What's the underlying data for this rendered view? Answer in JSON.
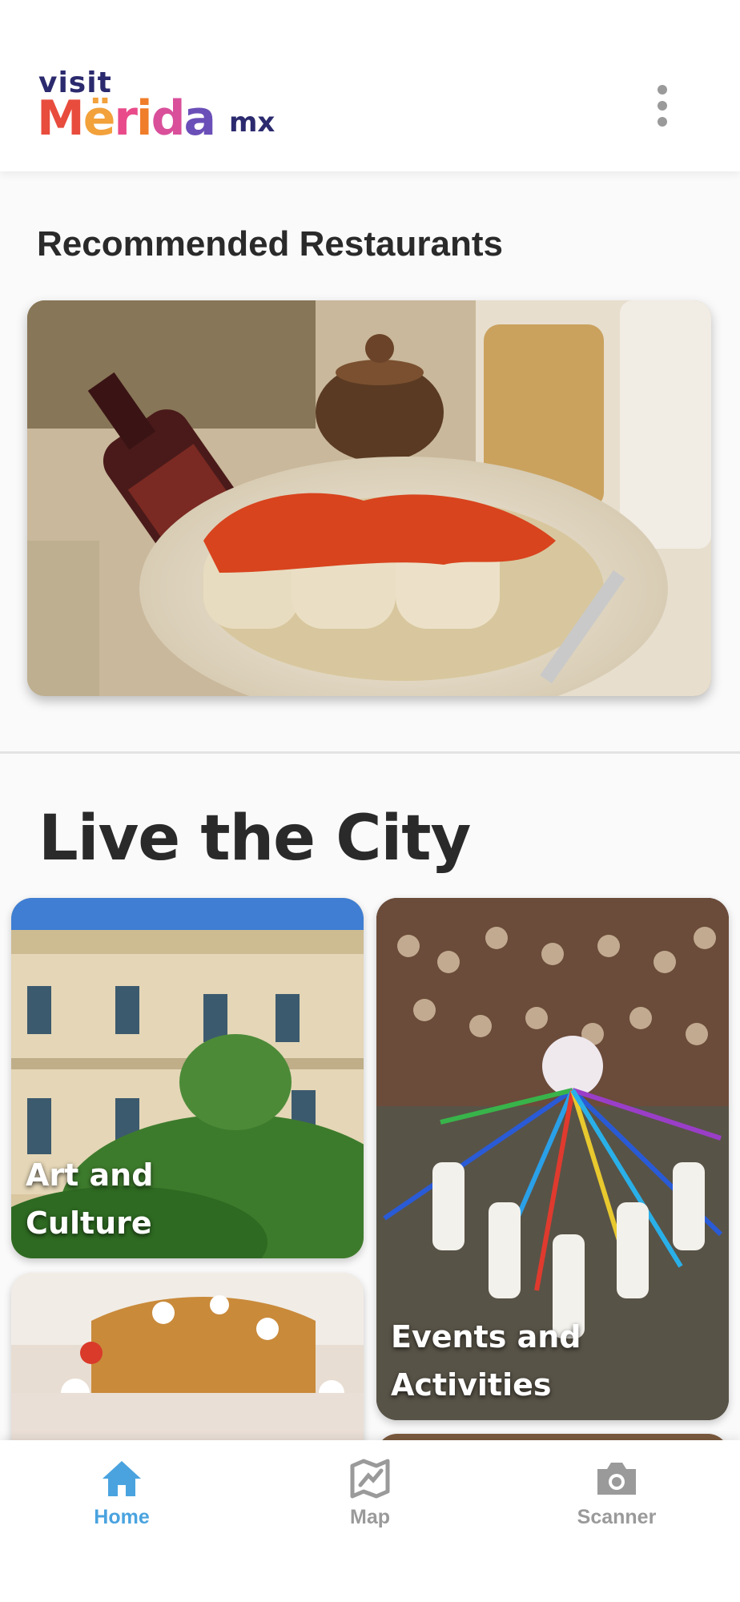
{
  "header": {
    "logo": {
      "visit": "visit",
      "merida_letters": [
        "M",
        "ë",
        "r",
        "i",
        "d",
        "a"
      ],
      "mx": "mx"
    },
    "menu_icon": "more-vertical-icon"
  },
  "recommended": {
    "title": "Recommended Restaurants"
  },
  "live_city": {
    "title": "Live the City",
    "tiles": [
      {
        "label": "Art and\nCulture"
      },
      {
        "label": "Events and\nActivities"
      },
      {
        "label": ""
      },
      {
        "label": ""
      }
    ]
  },
  "bottom_nav": {
    "items": [
      {
        "label": "Home",
        "icon": "home-icon",
        "active": true
      },
      {
        "label": "Map",
        "icon": "map-icon",
        "active": false
      },
      {
        "label": "Scanner",
        "icon": "camera-icon",
        "active": false
      }
    ]
  },
  "colors": {
    "active": "#4aa3df",
    "inactive": "#9a9a9a",
    "brand_dark": "#2b2a6e",
    "logo_letters": [
      "#e84c3d",
      "#f2a13b",
      "#e94b8a",
      "#f07d2a",
      "#d94f9a",
      "#6b4fb8"
    ]
  }
}
